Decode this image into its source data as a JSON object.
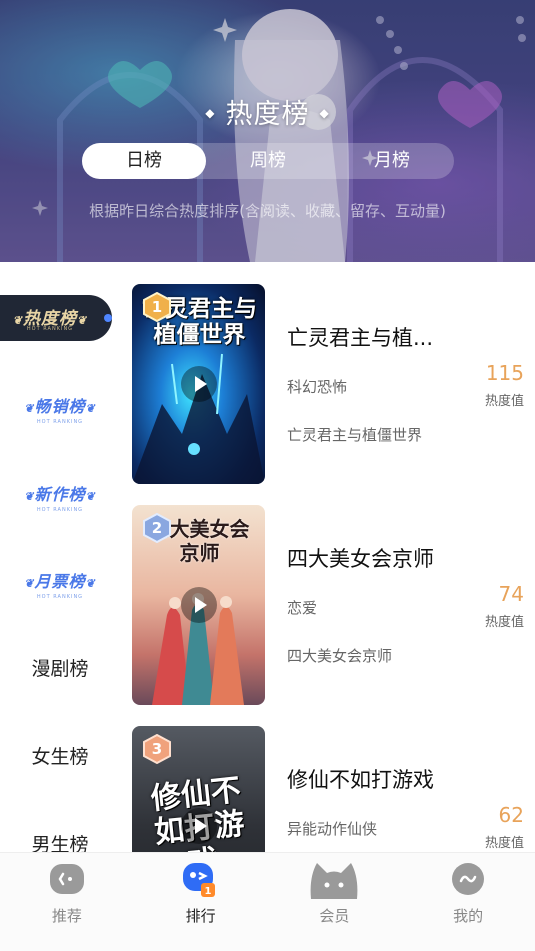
{
  "hero": {
    "title": "热度榜",
    "description": "根据昨日综合热度排序(含阅读、收藏、留存、互动量)",
    "period_tabs": [
      {
        "label": "日榜",
        "active": true
      },
      {
        "label": "周榜",
        "active": false
      },
      {
        "label": "月榜",
        "active": false
      }
    ]
  },
  "sidebar": {
    "items": [
      {
        "label": "热度榜",
        "sub": "HOT RANKING",
        "active": true
      },
      {
        "label": "畅销榜",
        "sub": "HOT RANKING"
      },
      {
        "label": "新作榜",
        "sub": "HOT RANKING"
      },
      {
        "label": "月票榜",
        "sub": "HOT RANKING"
      },
      {
        "label": "漫剧榜"
      },
      {
        "label": "女生榜"
      },
      {
        "label": "男生榜"
      }
    ]
  },
  "books": [
    {
      "rank": "1",
      "cover_text": "亡灵君主与植僵世界",
      "title": "亡灵君主与植...",
      "genre": "科幻恐怖",
      "desc": "亡灵君主与植僵世界",
      "heat": "115",
      "heat_label": "热度值"
    },
    {
      "rank": "2",
      "cover_text": "四大美女会京师",
      "title": "四大美女会京师",
      "genre": "恋爱",
      "desc": "四大美女会京师",
      "heat": "74",
      "heat_label": "热度值"
    },
    {
      "rank": "3",
      "cover_text": "修仙不如打游戏",
      "title": "修仙不如打游戏",
      "genre": "异能动作仙侠",
      "desc": "",
      "heat": "62",
      "heat_label": "热度值"
    }
  ],
  "tabbar": {
    "items": [
      {
        "label": "推荐",
        "icon": "recommend-icon"
      },
      {
        "label": "排行",
        "icon": "ranking-icon",
        "active": true
      },
      {
        "label": "会员",
        "icon": "vip-cat-icon"
      },
      {
        "label": "我的",
        "icon": "profile-icon"
      }
    ]
  },
  "colors": {
    "accent": "#e8a35a",
    "badge_blue": "#4a78e8",
    "badge_dark": "#202735",
    "gold": "#e9d6a6"
  }
}
